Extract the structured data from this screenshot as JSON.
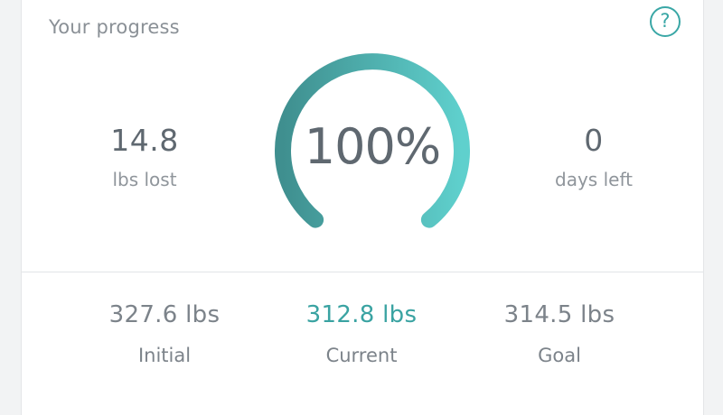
{
  "card": {
    "title": "Your progress",
    "help_symbol": "?"
  },
  "stats": {
    "lost": {
      "value": "14.8",
      "label": "lbs lost"
    },
    "days": {
      "value": "0",
      "label": "days left"
    }
  },
  "gauge": {
    "percent_text": "100%",
    "progress": 1.0,
    "color_start": "#3f8f8f",
    "color_end": "#5fd0cd"
  },
  "weights": [
    {
      "value": "327.6 lbs",
      "label": "Initial"
    },
    {
      "value": "312.8 lbs",
      "label": "Current"
    },
    {
      "value": "314.5 lbs",
      "label": "Goal"
    }
  ],
  "colors": {
    "accent": "#3aa7a6",
    "text": "#5f6870",
    "muted": "#8f959b"
  }
}
